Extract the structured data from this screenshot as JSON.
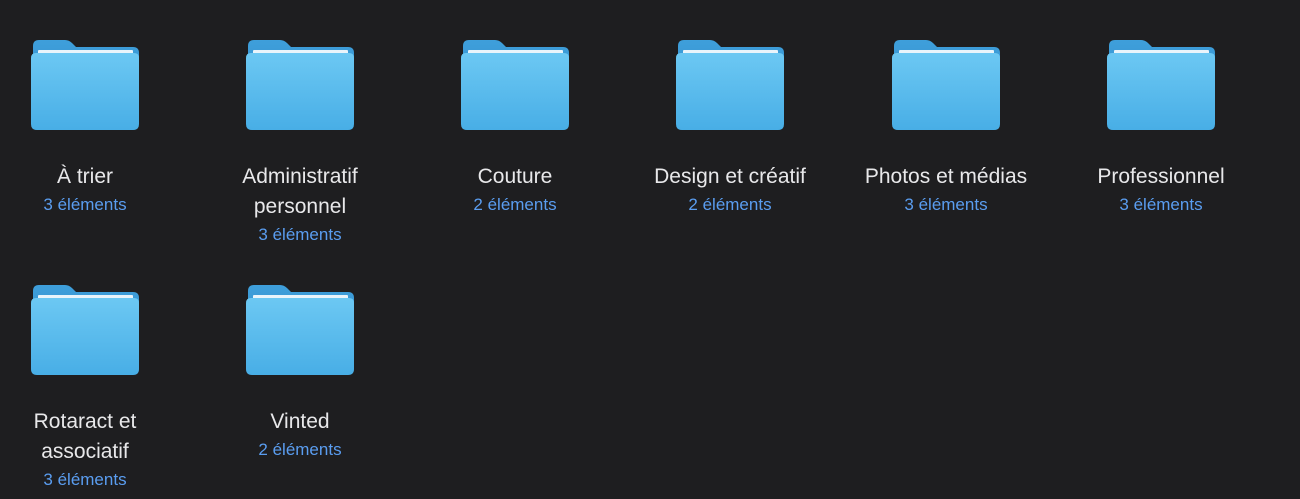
{
  "folders": [
    {
      "name": "À trier",
      "count": "3 éléments"
    },
    {
      "name": "Administratif\npersonnel",
      "count": "3 éléments"
    },
    {
      "name": "Couture",
      "count": "2 éléments"
    },
    {
      "name": "Design et créatif",
      "count": "2 éléments"
    },
    {
      "name": "Photos et médias",
      "count": "3 éléments"
    },
    {
      "name": "Professionnel",
      "count": "3 éléments"
    },
    {
      "name": "Rotaract et\nassociatif",
      "count": "3 éléments"
    },
    {
      "name": "Vinted",
      "count": "2 éléments"
    }
  ],
  "colors": {
    "background": "#1e1e20",
    "folder_back": "#4aaee6",
    "folder_front": "#62c0f0",
    "label": "#e8e8ea",
    "count": "#5a9df0"
  },
  "icon": "folder-icon"
}
